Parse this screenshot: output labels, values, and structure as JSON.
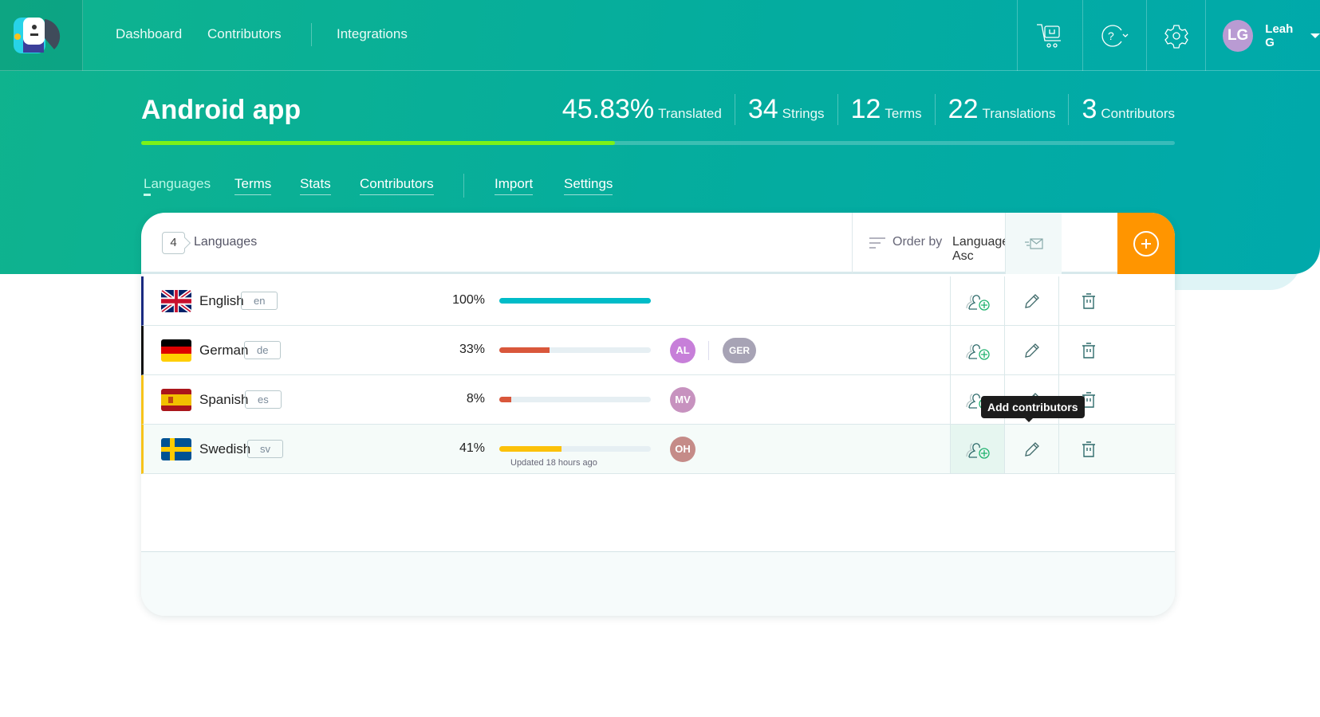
{
  "nav": {
    "links": [
      "Dashboard",
      "Contributors",
      "Integrations"
    ],
    "user": {
      "initials": "LG",
      "name": "Leah G",
      "avatar_color": "#b99bd3"
    }
  },
  "project": {
    "title": "Android app",
    "translated_pct": 45.83,
    "stats": [
      {
        "n": "45.83%",
        "l": "Translated"
      },
      {
        "n": "34",
        "l": "Strings"
      },
      {
        "n": "12",
        "l": "Terms"
      },
      {
        "n": "22",
        "l": "Translations"
      },
      {
        "n": "3",
        "l": "Contributors"
      }
    ]
  },
  "tabs": [
    "Languages",
    "Terms",
    "Stats",
    "Contributors",
    "Import",
    "Settings"
  ],
  "toolbar": {
    "count": "4",
    "label": "Languages",
    "order_label": "Order by",
    "order_value": "Language Asc"
  },
  "colors": {
    "accent": "#ff9500",
    "progress": "#7cf218"
  },
  "languages": [
    {
      "name": "English",
      "code": "en",
      "pct": "100%",
      "value": 100,
      "bar": "#00bcc8",
      "border": "#1a2a80",
      "flag": "gb",
      "avatars": []
    },
    {
      "name": "German",
      "code": "de",
      "pct": "33%",
      "value": 33,
      "bar": "#d9573b",
      "border": "#111111",
      "flag": "de",
      "avatars": [
        {
          "t": "AL",
          "c": "#c77fd9"
        }
      ],
      "team": {
        "t": "GER",
        "c": "#a7a3b5"
      }
    },
    {
      "name": "Spanish",
      "code": "es",
      "pct": "8%",
      "value": 8,
      "bar": "#d9573b",
      "border": "#f7c31b",
      "flag": "es",
      "avatars": [
        {
          "t": "MV",
          "c": "#c792bf"
        }
      ]
    },
    {
      "name": "Swedish",
      "code": "sv",
      "pct": "41%",
      "value": 41,
      "bar": "#fcc10a",
      "border": "#f7c31b",
      "flag": "se",
      "avatars": [
        {
          "t": "OH",
          "c": "#c58b88"
        }
      ],
      "updated": "Updated 18 hours ago"
    }
  ],
  "tooltip": "Add contributors"
}
